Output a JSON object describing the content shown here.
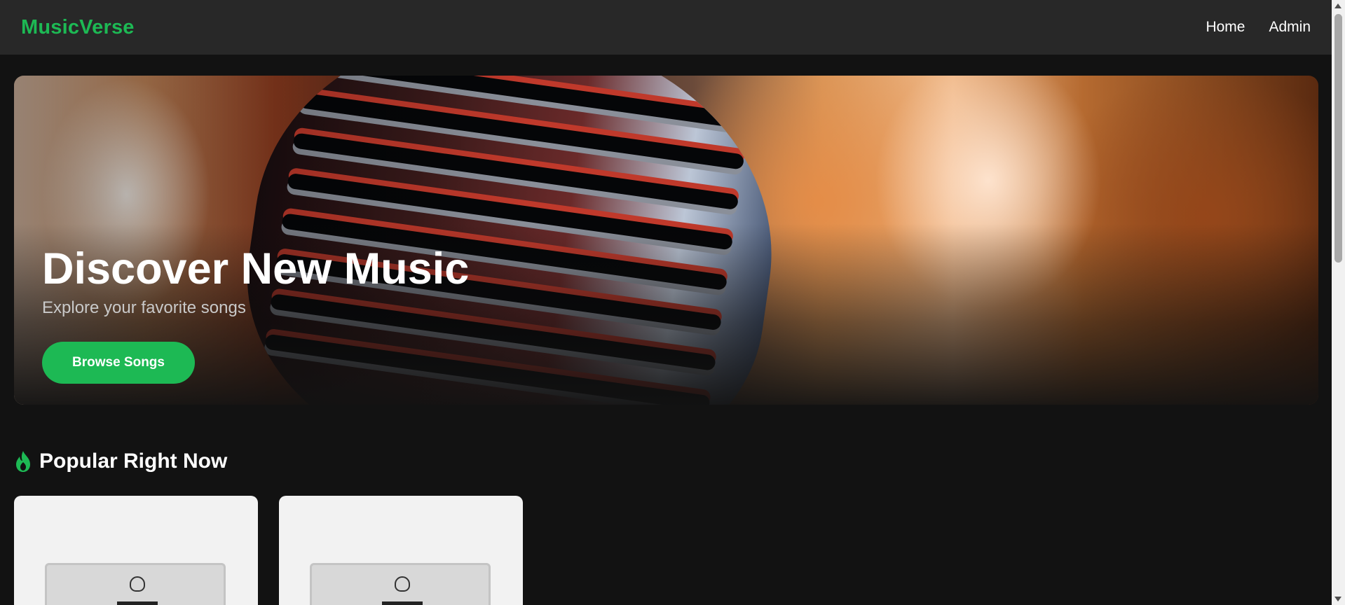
{
  "navbar": {
    "brand": "MusicVerse",
    "links": [
      {
        "label": "Home"
      },
      {
        "label": "Admin"
      }
    ]
  },
  "hero": {
    "title": "Discover New Music",
    "subtitle": "Explore your favorite songs",
    "cta_label": "Browse Songs"
  },
  "popular": {
    "title": "Popular Right Now",
    "icon": "fire-icon"
  },
  "colors": {
    "accent": "#1db954",
    "background": "#121212",
    "navbar": "#282828"
  }
}
